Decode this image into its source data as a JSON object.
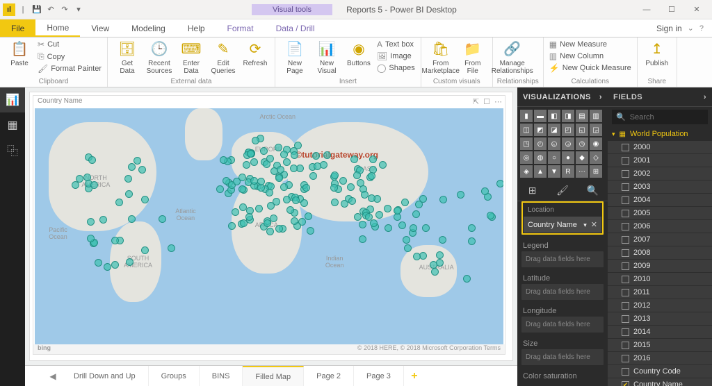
{
  "titlebar": {
    "visual_tools": "Visual tools",
    "doc_title": "Reports 5 - Power BI Desktop"
  },
  "menu": {
    "file": "File",
    "home": "Home",
    "view": "View",
    "modeling": "Modeling",
    "help": "Help",
    "format": "Format",
    "datadrill": "Data / Drill",
    "signin": "Sign in"
  },
  "ribbon": {
    "clipboard": {
      "paste": "Paste",
      "cut": "Cut",
      "copy": "Copy",
      "format_painter": "Format Painter",
      "grp": "Clipboard"
    },
    "external": {
      "get_data": "Get\nData",
      "recent_sources": "Recent\nSources",
      "enter_data": "Enter\nData",
      "edit_queries": "Edit\nQueries",
      "refresh": "Refresh",
      "grp": "External data"
    },
    "insert": {
      "new_page": "New\nPage",
      "new_visual": "New\nVisual",
      "buttons": "Buttons",
      "text_box": "Text box",
      "image": "Image",
      "shapes": "Shapes",
      "grp": "Insert"
    },
    "custom": {
      "marketplace": "From\nMarketplace",
      "file": "From\nFile",
      "grp": "Custom visuals"
    },
    "rel": {
      "manage": "Manage\nRelationships",
      "grp": "Relationships"
    },
    "calc": {
      "new_measure": "New Measure",
      "new_column": "New Column",
      "new_quick": "New Quick Measure",
      "grp": "Calculations"
    },
    "share": {
      "publish": "Publish",
      "grp": "Share"
    }
  },
  "visual": {
    "title": "Country Name",
    "watermark": "©tutorialgateway.org",
    "rmap": "© 2018 HERE, © 2018 Microsoft Corporation Terms",
    "bing": "bing",
    "continents": {
      "na": "NORTH\nAMERICA",
      "sa": "SOUTH\nAMERICA",
      "eu": "EUROPE",
      "af": "AFRICA",
      "as": "ASIA",
      "au": "AUSTRALIA",
      "arctic": "Arctic Ocean",
      "atlantic": "Atlantic\nOcean",
      "pacific": "Pacific\nOcean",
      "indian": "Indian\nOcean"
    }
  },
  "page_tabs": [
    "Drill Down and Up",
    "Groups",
    "BINS",
    "Filled Map",
    "Page 2",
    "Page 3"
  ],
  "viz_pane": {
    "header": "VISUALIZATIONS",
    "location_lbl": "Location",
    "location_chip": "Country Name",
    "legend": "Legend",
    "latitude": "Latitude",
    "longitude": "Longitude",
    "size": "Size",
    "color_sat": "Color saturation",
    "drag_hint": "Drag data fields here"
  },
  "fields_pane": {
    "header": "FIELDS",
    "search": "Search",
    "table": "World Population",
    "fields": [
      "2000",
      "2001",
      "2002",
      "2003",
      "2004",
      "2005",
      "2006",
      "2007",
      "2008",
      "2009",
      "2010",
      "2011",
      "2012",
      "2013",
      "2014",
      "2015",
      "2016",
      "Country Code",
      "Country Name"
    ],
    "checked": [
      "Country Name"
    ]
  }
}
